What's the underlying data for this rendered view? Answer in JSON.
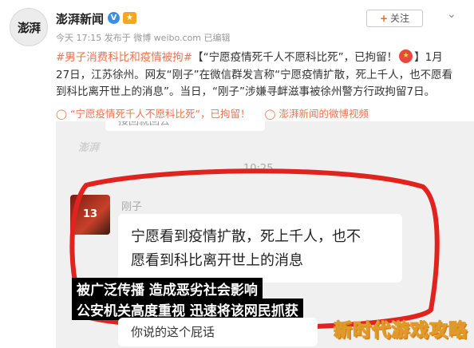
{
  "header": {
    "avatar_text": "澎湃",
    "account_name": "澎湃新闻",
    "verified_icon": "verified-v-icon",
    "vip_icon": "vip-level-icon",
    "meta": "今天 17:15 发布于 微博 weibo.com 已编辑",
    "follow_label": "关注",
    "menu_icon": "chevron-down-icon"
  },
  "post": {
    "topic": "#男子消费科比和疫情被拘#",
    "text_1": "【“宁愿疫情死千人不愿科比死”，已拘留！",
    "text_2": "】1月27日，江苏徐州。网友“刚子”在微信群发言称“宁愿疫情扩散，死上千人，也不愿看到科比离开世上的消息”。当日，“刚子”涉嫌寻衅滋事被徐州警方行政拘留7日。",
    "emoji_icon": "angry-emoji-icon"
  },
  "links": {
    "video_title": "“宁愿疫情死千人不愿科比死”，已拘留！",
    "video_source": "澎湃新闻的微博视频",
    "link_icon": "play-link-icon"
  },
  "media": {
    "prev_message": "接回就回去",
    "small_watermark": "澎湃",
    "timestamp": "10:25",
    "sender_avatar": "13",
    "sender_name": "刚子",
    "message_line_1": "宁愿看到疫情扩散，死上千人，也不",
    "message_line_2": "愿看到科比离开世上的消息",
    "caption_1": "被广泛传播 造成恶劣社会影响",
    "caption_2": "公安机关高度重视 迅速将该网民抓获",
    "reply": "你说的这个屁话",
    "site_watermark": "新时代游戏攻略"
  },
  "colors": {
    "accent": "#eb7350",
    "outline_red": "#e0231e"
  }
}
